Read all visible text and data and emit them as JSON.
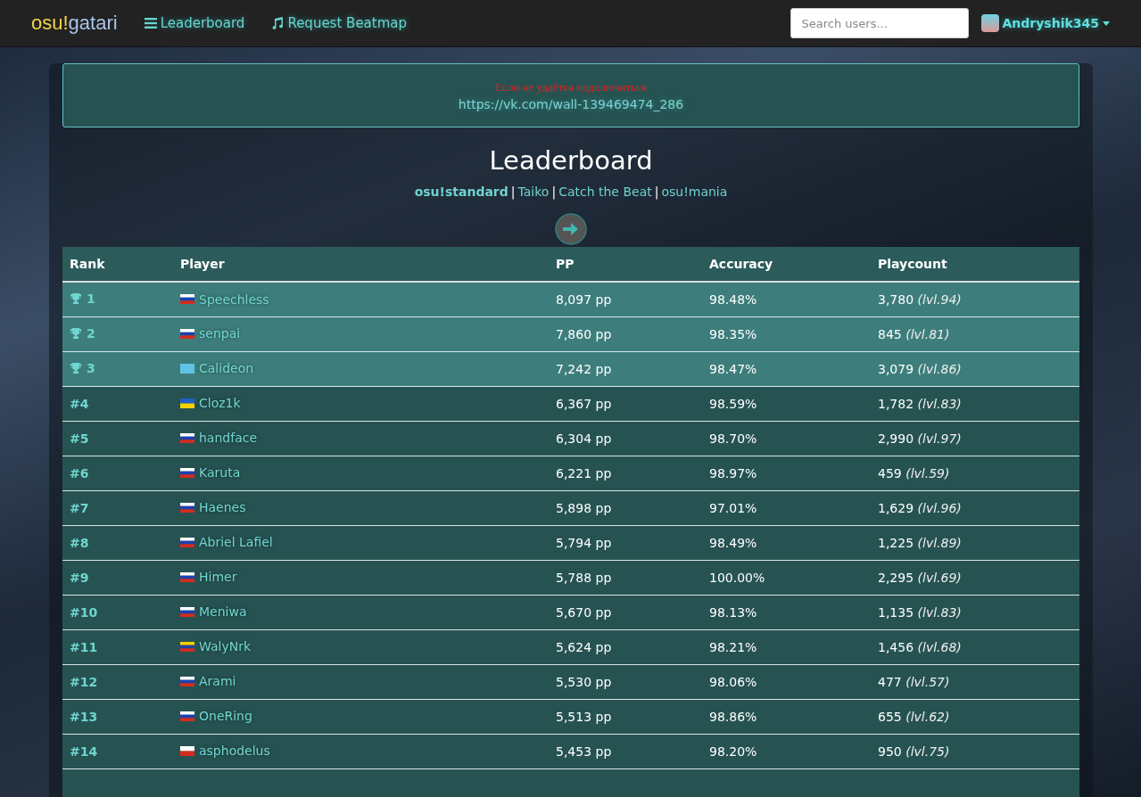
{
  "navbar": {
    "logo_left": "osu!",
    "logo_right": "gatari",
    "links": [
      {
        "label": "Leaderboard"
      },
      {
        "label": "Request Beatmap"
      }
    ],
    "search": {
      "placeholder": "Search users..."
    },
    "user": "Andryshik345"
  },
  "notice": {
    "message": "Если не удаётся подключиться",
    "link": "https://vk.com/wall-139469474_286"
  },
  "title": "Leaderboard",
  "mode_separator": "|",
  "modes": [
    {
      "label": "osu!standard",
      "selected": true
    },
    {
      "label": "Taiko",
      "selected": false
    },
    {
      "label": "Catch the Beat",
      "selected": false
    },
    {
      "label": "osu!mania",
      "selected": false
    }
  ],
  "table": {
    "columns": [
      "Rank",
      "Player",
      "PP",
      "Accuracy",
      "Playcount"
    ],
    "rows": [
      {
        "kind": "podium",
        "rank": "1",
        "flag": [
          {
            "color": "#ffffff"
          },
          {
            "color": "#1c3fb0"
          },
          {
            "color": "#d52b1e"
          }
        ],
        "player": "Speechless",
        "pp": "8,097 pp",
        "accuracy": "98.48%",
        "playcount": "3,780",
        "level": "(lvl.94)"
      },
      {
        "kind": "podium",
        "rank": "2",
        "flag": [
          {
            "color": "#ffffff"
          },
          {
            "color": "#1c3fb0"
          },
          {
            "color": "#d52b1e"
          }
        ],
        "player": "senpai",
        "pp": "7,860 pp",
        "accuracy": "98.35%",
        "playcount": "845",
        "level": "(lvl.81)"
      },
      {
        "kind": "podium",
        "rank": "3",
        "flag": [
          {
            "color": "#5fc3e4"
          }
        ],
        "player": "Calideon",
        "pp": "7,242 pp",
        "accuracy": "98.47%",
        "playcount": "3,079",
        "level": "(lvl.86)"
      },
      {
        "kind": "regular",
        "rank": "#4",
        "flag": [
          {
            "color": "#1f5fc8"
          },
          {
            "color": "#f5d000"
          }
        ],
        "player": "Cloz1k",
        "pp": "6,367 pp",
        "accuracy": "98.59%",
        "playcount": "1,782",
        "level": "(lvl.83)"
      },
      {
        "kind": "regular",
        "rank": "#5",
        "flag": [
          {
            "color": "#ffffff"
          },
          {
            "color": "#1c3fb0"
          },
          {
            "color": "#d52b1e"
          }
        ],
        "player": "handface",
        "pp": "6,304 pp",
        "accuracy": "98.70%",
        "playcount": "2,990",
        "level": "(lvl.97)"
      },
      {
        "kind": "regular",
        "rank": "#6",
        "flag": [
          {
            "color": "#ffffff"
          },
          {
            "color": "#1c3fb0"
          },
          {
            "color": "#d52b1e"
          }
        ],
        "player": "Karuta",
        "pp": "6,221 pp",
        "accuracy": "98.97%",
        "playcount": "459",
        "level": "(lvl.59)"
      },
      {
        "kind": "regular",
        "rank": "#7",
        "flag": [
          {
            "color": "#ffffff"
          },
          {
            "color": "#1c3fb0"
          },
          {
            "color": "#d52b1e"
          }
        ],
        "player": "Haenes",
        "pp": "5,898 pp",
        "accuracy": "97.01%",
        "playcount": "1,629",
        "level": "(lvl.96)"
      },
      {
        "kind": "regular",
        "rank": "#8",
        "flag": [
          {
            "color": "#ffffff"
          },
          {
            "color": "#1c3fb0"
          },
          {
            "color": "#d52b1e"
          }
        ],
        "player": "Abriel Lafiel",
        "pp": "5,794 pp",
        "accuracy": "98.49%",
        "playcount": "1,225",
        "level": "(lvl.89)"
      },
      {
        "kind": "regular",
        "rank": "#9",
        "flag": [
          {
            "color": "#ffffff"
          },
          {
            "color": "#1c3fb0"
          },
          {
            "color": "#d52b1e"
          }
        ],
        "player": "Himer",
        "pp": "5,788 pp",
        "accuracy": "100.00%",
        "playcount": "2,295",
        "level": "(lvl.69)"
      },
      {
        "kind": "regular",
        "rank": "#10",
        "flag": [
          {
            "color": "#ffffff"
          },
          {
            "color": "#1c3fb0"
          },
          {
            "color": "#d52b1e"
          }
        ],
        "player": "Meniwa",
        "pp": "5,670 pp",
        "accuracy": "98.13%",
        "playcount": "1,135",
        "level": "(lvl.83)"
      },
      {
        "kind": "regular",
        "rank": "#11",
        "flag": [
          {
            "color": "#f5d000"
          },
          {
            "color": "#1f3fa0"
          },
          {
            "color": "#d52b1e"
          }
        ],
        "player": "WalyNrk",
        "pp": "5,624 pp",
        "accuracy": "98.21%",
        "playcount": "1,456",
        "level": "(lvl.68)"
      },
      {
        "kind": "regular",
        "rank": "#12",
        "flag": [
          {
            "color": "#ffffff"
          },
          {
            "color": "#1c3fb0"
          },
          {
            "color": "#d52b1e"
          }
        ],
        "player": "Arami",
        "pp": "5,530 pp",
        "accuracy": "98.06%",
        "playcount": "477",
        "level": "(lvl.57)"
      },
      {
        "kind": "regular",
        "rank": "#13",
        "flag": [
          {
            "color": "#ffffff"
          },
          {
            "color": "#1c3fb0"
          },
          {
            "color": "#d52b1e"
          }
        ],
        "player": "OneRing",
        "pp": "5,513 pp",
        "accuracy": "98.86%",
        "playcount": "655",
        "level": "(lvl.62)"
      },
      {
        "kind": "regular",
        "rank": "#14",
        "flag": [
          {
            "color": "#ffffff"
          },
          {
            "color": "#d52b1e"
          }
        ],
        "player": "asphodelus",
        "pp": "5,453 pp",
        "accuracy": "98.20%",
        "playcount": "950",
        "level": "(lvl.75)"
      }
    ]
  }
}
